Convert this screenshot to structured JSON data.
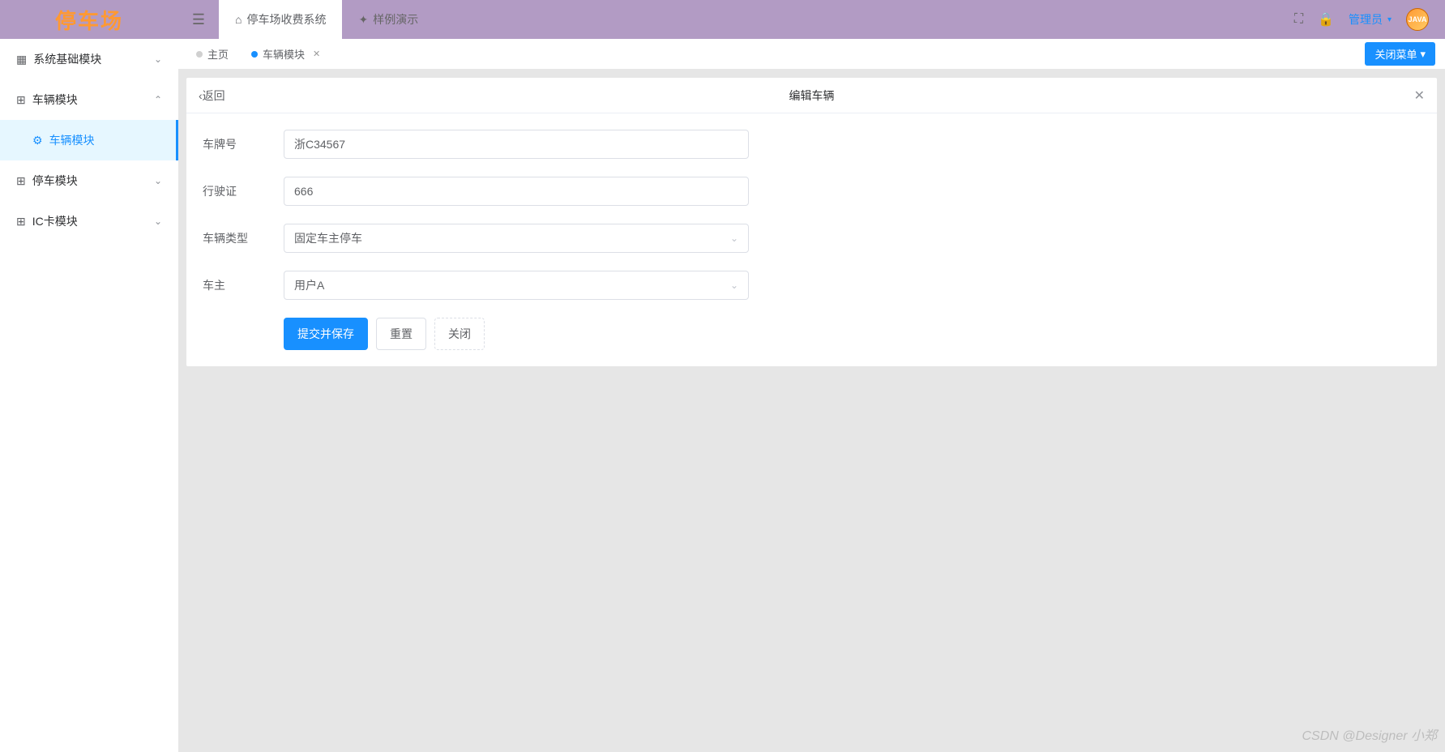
{
  "logo": "停车场",
  "topbar": {
    "nav": [
      {
        "label": "停车场收费系统",
        "icon": "home"
      },
      {
        "label": "样例演示",
        "icon": "sparkle"
      }
    ],
    "user_name": "管理员",
    "avatar_text": "JAVA"
  },
  "sidebar": {
    "items": [
      {
        "label": "系统基础模块",
        "expanded": false
      },
      {
        "label": "车辆模块",
        "expanded": true
      },
      {
        "label": "停车模块",
        "expanded": false
      },
      {
        "label": "IC卡模块",
        "expanded": false
      }
    ],
    "submenu": {
      "label": "车辆模块"
    }
  },
  "tabs": {
    "items": [
      {
        "label": "主页",
        "active": false,
        "closable": false
      },
      {
        "label": "车辆模块",
        "active": true,
        "closable": true
      }
    ],
    "close_menu_label": "关闭菜单"
  },
  "panel": {
    "back_label": "返回",
    "title": "编辑车辆"
  },
  "form": {
    "plate": {
      "label": "车牌号",
      "value": "浙C34567"
    },
    "license": {
      "label": "行驶证",
      "value": "666"
    },
    "vehicle_type": {
      "label": "车辆类型",
      "value": "固定车主停车"
    },
    "owner": {
      "label": "车主",
      "value": "用户A"
    },
    "buttons": {
      "submit": "提交并保存",
      "reset": "重置",
      "close": "关闭"
    }
  },
  "watermark": "CSDN @Designer 小郑"
}
